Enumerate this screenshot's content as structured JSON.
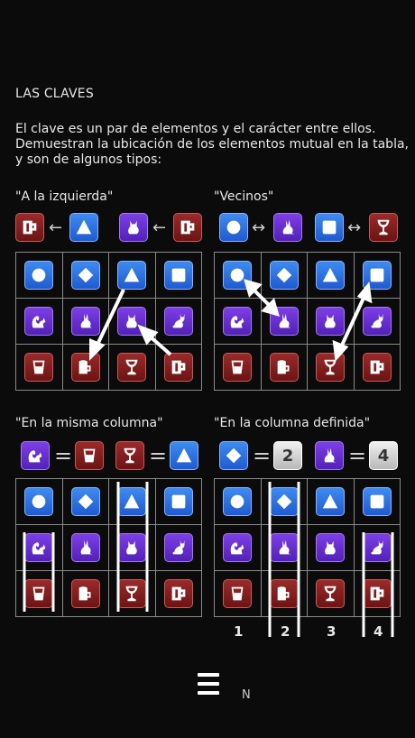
{
  "title": "LAS CLAVES",
  "intro": "El clave es un par de elementos y el carácter entre ellos. Demuestran la ubicación de los elementos mutual en la tabla, y son de algunos tipos:",
  "sections": {
    "left_of": {
      "label": "\"A la izquierda\"",
      "symbol": "←"
    },
    "neighbors": {
      "label": "\"Vecinos\"",
      "symbol": "↔"
    },
    "same_column": {
      "label": "\"En la misma columna\"",
      "symbol": "="
    },
    "defined_column": {
      "label": "\"En la columna definida\"",
      "symbol": "="
    }
  },
  "grid_rows": [
    [
      "circle",
      "diamond",
      "triangle",
      "square"
    ],
    [
      "squirrel",
      "rabbit",
      "cat",
      "sitting-cat"
    ],
    [
      "glass",
      "mug",
      "goblet",
      "stein"
    ]
  ],
  "row_colors": [
    "#2f6fe0",
    "#6a2fd0",
    "#8a2020"
  ],
  "column_numbers": [
    "1",
    "2",
    "3",
    "4"
  ],
  "clue_numbers": {
    "a": "2",
    "b": "4"
  },
  "footer": {
    "text": "N"
  }
}
